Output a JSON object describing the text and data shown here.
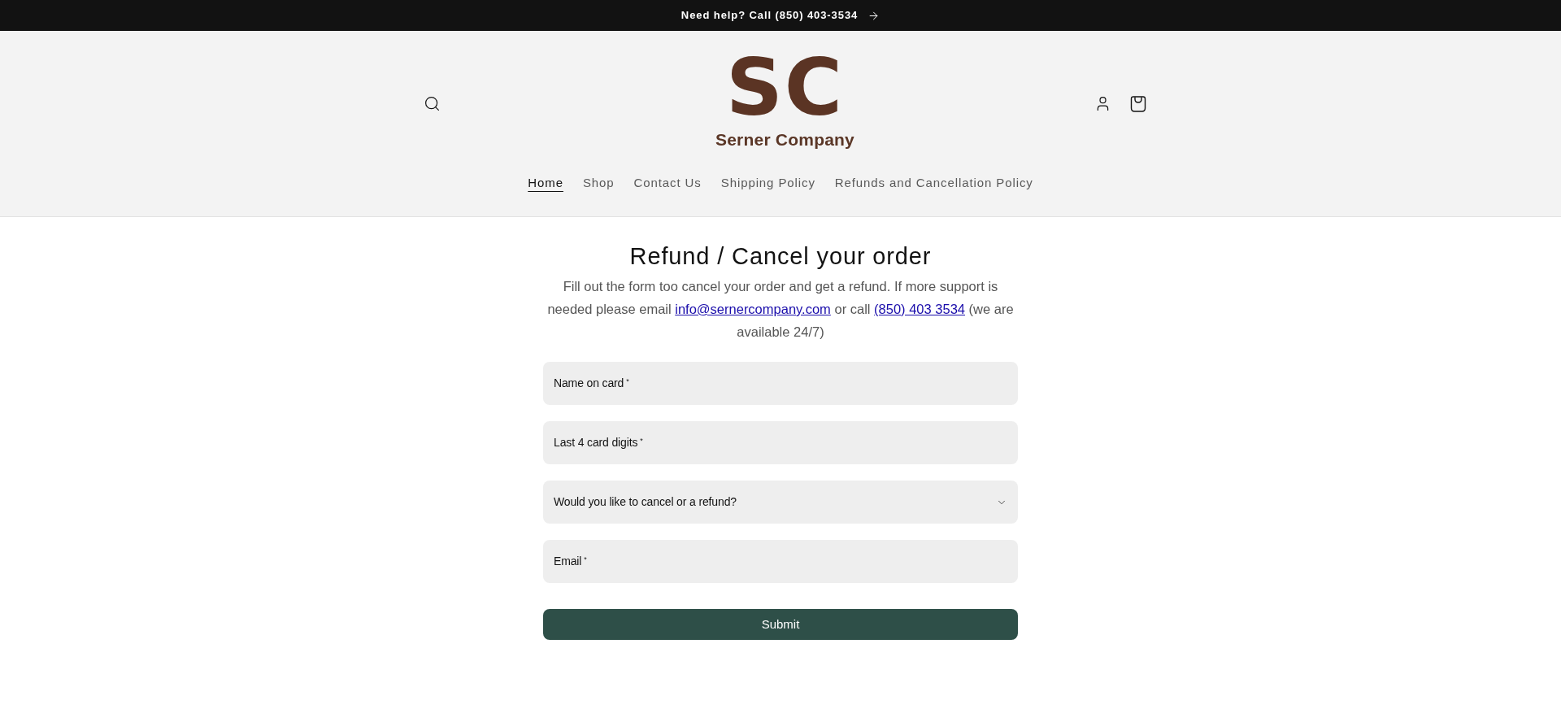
{
  "announcement_bar": {
    "text": "Need help? Call (850) 403-3534"
  },
  "header": {
    "logo_mark": "SC",
    "brand_name": "Serner Company"
  },
  "nav": [
    {
      "label": "Home",
      "selected": true
    },
    {
      "label": "Shop",
      "selected": false
    },
    {
      "label": "Contact Us",
      "selected": false
    },
    {
      "label": "Shipping Policy",
      "selected": false
    },
    {
      "label": "Refunds and Cancellation Policy",
      "selected": false
    }
  ],
  "page": {
    "title": "Refund / Cancel your order",
    "intro": {
      "before": "Fill out the form too cancel your order and get a refund. If more support is needed please email",
      "email_link": "info@sernercompany.com",
      "middle": "or call",
      "phone_link": "(850) 403 3534",
      "after": "(we are available 24/7)"
    }
  },
  "form": {
    "fields": [
      {
        "kind": "text",
        "label": "Name on card",
        "required_mark": "*"
      },
      {
        "kind": "text",
        "label": "Last 4 card digits",
        "required_mark": "*"
      },
      {
        "kind": "select",
        "label": "Would you like to cancel or a refund?"
      },
      {
        "kind": "text",
        "label": "Email",
        "required_mark": "*"
      }
    ],
    "submit": "Submit"
  }
}
